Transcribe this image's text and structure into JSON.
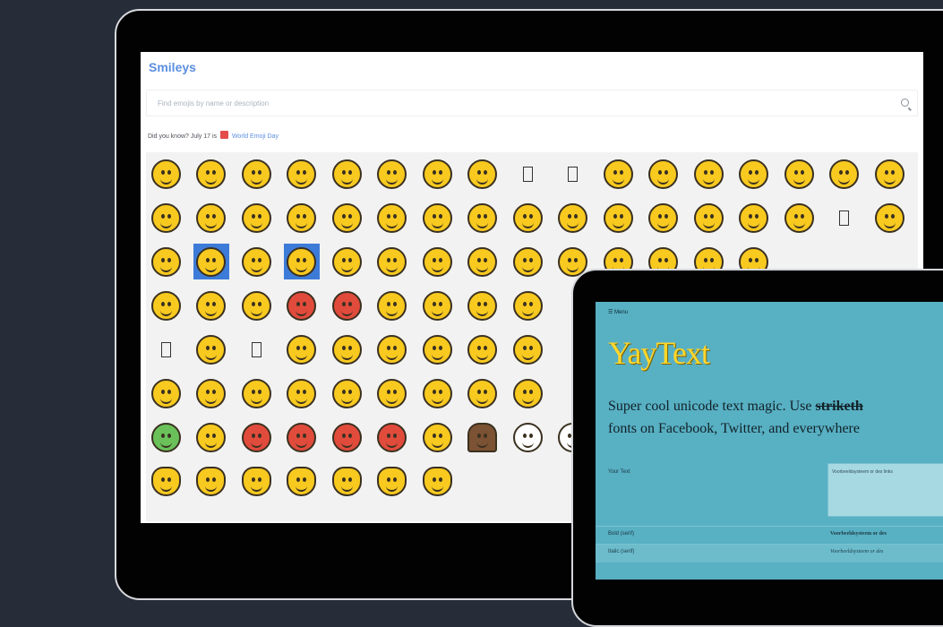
{
  "smileys": {
    "title": "Smileys",
    "search_placeholder": "Find emojis by name or description",
    "did_you_know_prefix": "Did you know? July 17 is",
    "did_you_know_link": "World Emoji Day",
    "emoji_rows": [
      [
        "grinning-face-icon",
        "grinning-face-big-eyes-icon",
        "grinning-face-smiling-eyes-icon",
        "beaming-face-icon",
        "squinting-face-icon",
        "sweat-smile-icon",
        "tears-of-joy-icon",
        "rofl-icon",
        "tofu-box-icon",
        "tofu-box-icon",
        "small-face-icon",
        "smiling-face-icon",
        "halo-face-icon",
        "slight-smile-icon",
        "upside-down-face-icon",
        "wink-face-icon",
        "relieved-face-icon"
      ],
      [
        "heart-eyes-icon",
        "smiling-hearts-icon",
        "kissing-heart-icon",
        "kissing-face-icon",
        "kissing-closed-eyes-icon",
        "kissing-smiling-eyes-icon",
        "yum-face-icon",
        "tongue-face-icon",
        "squint-tongue-icon",
        "wink-tongue-icon",
        "zany-face-icon",
        "money-mouth-icon",
        "monocle-face-icon",
        "nerd-face-icon",
        "sunglasses-face-icon",
        "tofu-box-icon",
        "star-struck-icon"
      ],
      [
        "crying-laughing-combo-icon",
        "up-down-arrow-combo-icon",
        "combo-face-icon",
        "left-arrow-combo-icon",
        "pensive-face-icon",
        "worried-face-icon",
        "confused-face-icon",
        "frowning-face-icon",
        "persevere-face-icon",
        "tired-face-icon",
        "weary-face-icon",
        "sad-face-icon",
        "triumph-face-icon",
        "angry-face-icon"
      ],
      [
        "cold-sweat-combo-icon",
        "steam-combo-icon",
        "angry-sulk-icon",
        "pouting-face-icon",
        "cursing-face-icon",
        "exploding-head-icon",
        "flushed-face-icon",
        "hot-face-icon",
        "cold-face-icon"
      ],
      [
        "tofu-box-icon",
        "thinking-face-icon",
        "tofu-box-icon",
        "shushing-face-icon",
        "hand-over-mouth-icon",
        "lying-face-icon",
        "no-mouth-combo-icon",
        "grimace-combo-icon",
        "expressionless-face-icon"
      ],
      [
        "hushed-face-icon",
        "astonished-face-icon",
        "yawning-face-icon",
        "sleeping-face-icon",
        "relieved-sleepy-icon",
        "drooling-face-icon",
        "dizzy-combo-icon",
        "mask-combo-icon",
        "neutral-face-icon"
      ],
      [
        "nauseated-face-icon",
        "cowboy-face-icon",
        "smiling-devil-icon",
        "angry-devil-icon",
        "ogre-icon",
        "goblin-icon",
        "clown-face-icon",
        "pile-of-poo-icon",
        "ghost-icon",
        "skull-icon"
      ],
      [
        "grinning-cat-icon",
        "heart-eyes-cat-icon",
        "smiling-cat-icon",
        "cat-tears-of-joy-icon",
        "wry-cat-icon",
        "kissing-cat-icon",
        "smirking-cat-icon"
      ]
    ]
  },
  "yaytext": {
    "menu": "☰ Menu",
    "title": "YayText",
    "desc_line1_a": "Super cool unicode text magic. Use",
    "desc_line1_strike": "striketh",
    "desc_line2": "fonts on Facebook, Twitter, and everywhere",
    "your_text_label": "Your Text",
    "your_text_value": "Voorbeeldsysteem or des links",
    "rows": [
      {
        "label": "Bold (serif)",
        "value": "Voorbeeldsysteem or des"
      },
      {
        "label": "Italic (serif)",
        "value": "Voorbeeldsysteem or des"
      }
    ]
  }
}
